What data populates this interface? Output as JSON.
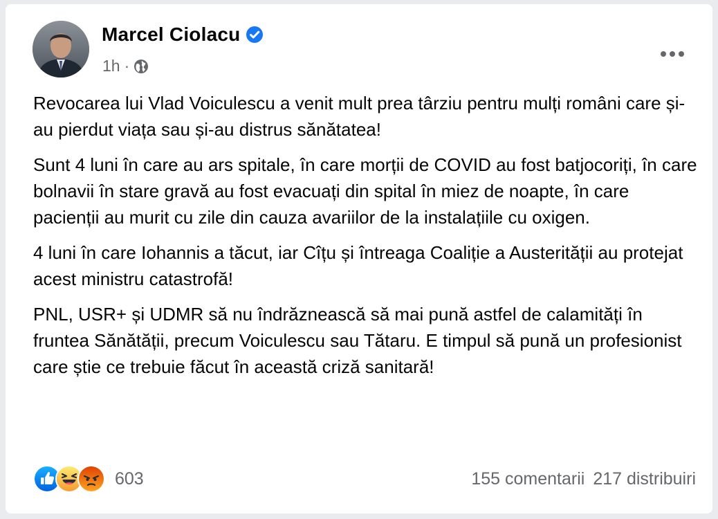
{
  "post": {
    "author": "Marcel Ciolacu",
    "time": "1h",
    "separator": "·",
    "paragraphs": [
      "Revocarea lui Vlad Voiculescu a venit mult prea târziu pentru mulți români care și-au pierdut viața sau și-au distrus sănătatea!",
      "Sunt 4 luni în care au ars spitale, în care morții de COVID au fost batjocoriți, în care bolnavii în stare gravă au fost evacuați din spital în miez de noapte, în care pacienții au murit cu zile din cauza avariilor de la instalațiile cu oxigen.",
      "4 luni în care Iohannis a tăcut, iar Cîțu și întreaga Coaliție a Austerității au protejat acest ministru catastrofă!",
      "PNL, USR+ și UDMR să nu îndrăznească să mai pună astfel de calamități în fruntea Sănătății, precum Voiculescu sau Tătaru. E timpul să pună un profesionist care știe ce trebuie făcut în această criză sanitară!"
    ]
  },
  "icons": {
    "verified": "verified-badge-icon",
    "audience": "globe-icon",
    "more": "more-options-icon",
    "reactions": [
      "like-icon",
      "haha-icon",
      "angry-icon"
    ]
  },
  "footer": {
    "reaction_count": "603",
    "comments": "155 comentarii",
    "shares": "217 distribuiri"
  },
  "colors": {
    "brand_blue": "#1877f2",
    "secondary_text": "#65676b",
    "primary_text": "#050505"
  }
}
